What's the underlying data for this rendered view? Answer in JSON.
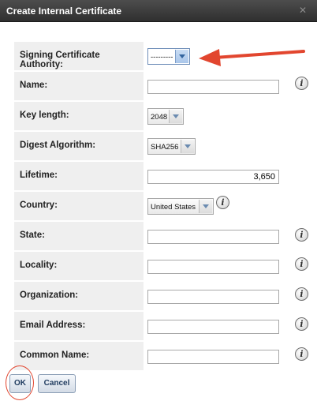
{
  "dialog": {
    "title": "Create Internal Certificate",
    "close_icon": "close-icon"
  },
  "form": {
    "signing_ca": {
      "label": "Signing Certificate Authority:",
      "value": "---------"
    },
    "name": {
      "label": "Name:",
      "value": ""
    },
    "key_length": {
      "label": "Key length:",
      "value": "2048"
    },
    "digest": {
      "label": "Digest Algorithm:",
      "value": "SHA256"
    },
    "lifetime": {
      "label": "Lifetime:",
      "value": "3,650"
    },
    "country": {
      "label": "Country:",
      "value": "United States"
    },
    "state": {
      "label": "State:",
      "value": ""
    },
    "locality": {
      "label": "Locality:",
      "value": ""
    },
    "organization": {
      "label": "Organization:",
      "value": ""
    },
    "email": {
      "label": "Email Address:",
      "value": ""
    },
    "common_name": {
      "label": "Common Name:",
      "value": ""
    }
  },
  "buttons": {
    "ok": "OK",
    "cancel": "Cancel"
  },
  "info_icon_glyph": "i",
  "colors": {
    "annotation": "#e2462f",
    "titlebar": "#3a3a3a",
    "label_bg": "#efefef"
  }
}
